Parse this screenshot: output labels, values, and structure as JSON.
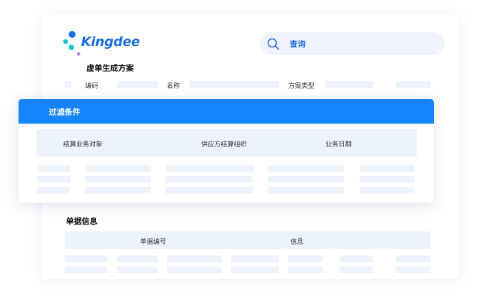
{
  "brand": {
    "logo_text": "Kingdee"
  },
  "search": {
    "label": "查询"
  },
  "scheme": {
    "title": "虚单生成方案",
    "fields": {
      "code": "编码",
      "name": "名称",
      "type": "方案类型"
    }
  },
  "filter_panel": {
    "title": "过滤条件",
    "fields": {
      "settlement_object": "结算业务对象",
      "supplier_org": "供应方结算组织",
      "business_date": "业务日期"
    }
  },
  "doc_info": {
    "title": "单据信息",
    "columns": {
      "doc_number": "单据编号",
      "info": "信息"
    }
  },
  "colors": {
    "primary": "#1884fb",
    "brand_blue": "#1a6ee6",
    "placeholder": "#edf3fd",
    "accent_cyan": "#19c7c6",
    "accent_purple": "#b67cf5"
  },
  "icons": {
    "search": "search-icon"
  }
}
